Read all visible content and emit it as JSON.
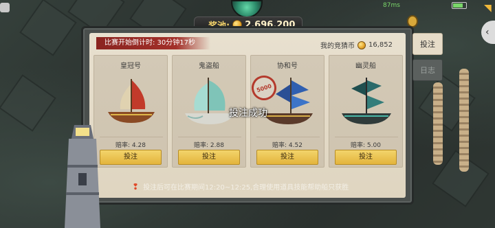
{
  "header": {
    "prize_label": "奖池:",
    "prize_value": "2,696,200"
  },
  "panel": {
    "countdown": "比赛开始倒计时: 30分钟17秒",
    "my_coins_label": "我的竞猜币",
    "my_coins_value": "16,852"
  },
  "ships": [
    {
      "name": "皇冠号",
      "odds": "赔率: 4.28",
      "bet_label": "投注"
    },
    {
      "name": "鬼盗船",
      "odds": "赔率: 2.88",
      "bet_label": "投注"
    },
    {
      "name": "协和号",
      "odds": "赔率: 4.52",
      "bet_label": "投注"
    },
    {
      "name": "幽灵船",
      "odds": "赔率: 5.00",
      "bet_label": "投注"
    }
  ],
  "stamp_value": "5000",
  "toast": "投注成功",
  "footer_note": "投注后可在比赛期间12:20~12:25,合理使用道具技能帮助船只获胜",
  "tabs": [
    {
      "label": "投注",
      "active": true
    },
    {
      "label": "日志",
      "active": false
    }
  ],
  "status": {
    "wifi": "87ms"
  },
  "colors": {
    "accent_gold": "#e3b43c",
    "countdown_red": "#a3302a",
    "panel_bg": "#e8e0cf"
  }
}
